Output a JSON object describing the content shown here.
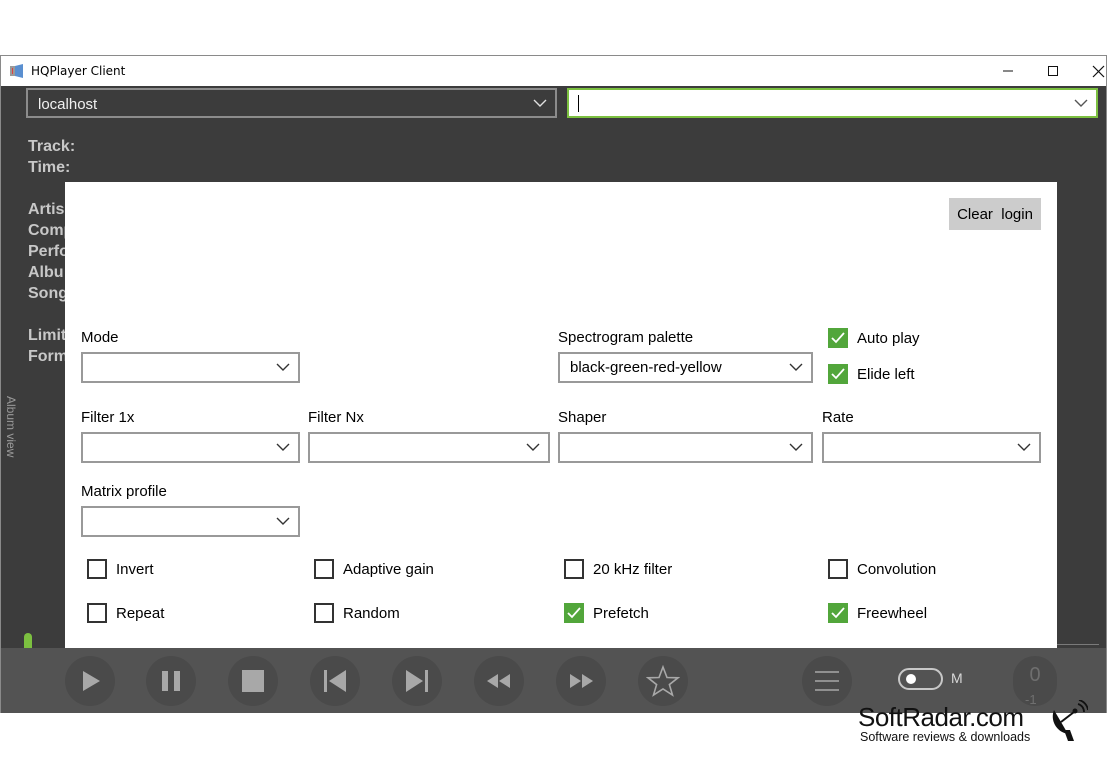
{
  "window": {
    "title": "HQPlayer Client"
  },
  "toolbar": {
    "host_value": "localhost",
    "search_value": ""
  },
  "info_labels": [
    "Track:",
    "Time:",
    "Artis",
    "Comp",
    "Perfo",
    "Albu",
    "Song",
    "Limit",
    "Form"
  ],
  "side_tab": {
    "label": "Album view"
  },
  "dialog": {
    "clear_login_label": "Clear  login",
    "mode": {
      "label": "Mode",
      "value": ""
    },
    "spectrogram": {
      "label": "Spectrogram palette",
      "value": "black-green-red-yellow"
    },
    "auto_play": {
      "label": "Auto play",
      "checked": true
    },
    "elide_left": {
      "label": "Elide left",
      "checked": true
    },
    "filter1x": {
      "label": "Filter 1x",
      "value": ""
    },
    "filterNx": {
      "label": "Filter Nx",
      "value": ""
    },
    "shaper": {
      "label": "Shaper",
      "value": ""
    },
    "rate": {
      "label": "Rate",
      "value": ""
    },
    "matrix": {
      "label": "Matrix profile",
      "value": ""
    },
    "checks": {
      "invert": {
        "label": "Invert",
        "checked": false
      },
      "adaptive_gain": {
        "label": "Adaptive gain",
        "checked": false
      },
      "khz_filter": {
        "label": "20 kHz filter",
        "checked": false
      },
      "convolution": {
        "label": "Convolution",
        "checked": false
      },
      "repeat": {
        "label": "Repeat",
        "checked": false
      },
      "random": {
        "label": "Random",
        "checked": false
      },
      "prefetch": {
        "label": "Prefetch",
        "checked": true
      },
      "freewheel": {
        "label": "Freewheel",
        "checked": true
      }
    }
  },
  "controls": {
    "icons": [
      "play-icon",
      "pause-icon",
      "stop-icon",
      "previous-icon",
      "next-icon",
      "rewind-icon",
      "fast-forward-icon",
      "star-icon",
      "menu-icon"
    ],
    "m_label": "M",
    "counter_value": "0",
    "counter_sub": "-1"
  },
  "watermark": {
    "main": "SoftRadar.com",
    "sub": "Software reviews & downloads"
  },
  "colors": {
    "accent": "#7cc040",
    "check": "#52a63b",
    "window_bg": "#3c3c3c",
    "controls_bg": "#535353"
  }
}
